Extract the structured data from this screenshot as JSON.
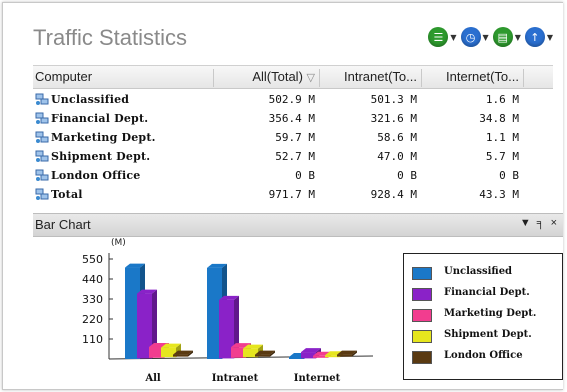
{
  "window": {
    "title": "Traffic Statistics"
  },
  "toolbar": {
    "buttons": [
      {
        "icon": "list-icon",
        "glyph": "☰",
        "color": "#2e9a2e"
      },
      {
        "icon": "clock-icon",
        "glyph": "◷",
        "color": "#2a6fd0"
      },
      {
        "icon": "export-icon",
        "glyph": "▤",
        "color": "#2e9a2e"
      },
      {
        "icon": "upload-icon",
        "glyph": "↑",
        "color": "#2a6fd0"
      }
    ]
  },
  "table": {
    "columns": [
      "Computer",
      "All(Total)",
      "Intranet(To...",
      "Internet(To..."
    ],
    "sort_indicator": "▽",
    "rows": [
      {
        "name": "Unclassified",
        "all": "502.9 M",
        "intranet": "501.3 M",
        "internet": "1.6 M"
      },
      {
        "name": "Financial Dept.",
        "all": "356.4 M",
        "intranet": "321.6 M",
        "internet": "34.8 M"
      },
      {
        "name": "Marketing Dept.",
        "all": "59.7 M",
        "intranet": "58.6 M",
        "internet": "1.1 M"
      },
      {
        "name": "Shipment Dept.",
        "all": "52.7 M",
        "intranet": "47.0 M",
        "internet": "5.7 M"
      },
      {
        "name": "London Office",
        "all": "0 B",
        "intranet": "0 B",
        "internet": "0 B"
      },
      {
        "name": "Total",
        "all": "971.7 M",
        "intranet": "928.4 M",
        "internet": "43.3 M"
      }
    ]
  },
  "panel": {
    "title": "Bar Chart",
    "controls": "▼ ╕ ×"
  },
  "chart_data": {
    "type": "bar",
    "ylabel": "(M)",
    "ylim": [
      0,
      550
    ],
    "yticks": [
      110,
      220,
      330,
      440,
      550
    ],
    "categories": [
      "All",
      "Intranet",
      "Internet"
    ],
    "series": [
      {
        "name": "Unclassified",
        "color": "#1a78c8",
        "values": [
          502.9,
          501.3,
          1.6
        ]
      },
      {
        "name": "Financial Dept.",
        "color": "#8a22c8",
        "values": [
          356.4,
          321.6,
          34.8
        ]
      },
      {
        "name": "Marketing Dept.",
        "color": "#f23d8f",
        "values": [
          59.7,
          58.6,
          1.1
        ]
      },
      {
        "name": "Shipment Dept.",
        "color": "#e6e61e",
        "values": [
          52.7,
          47.0,
          5.7
        ]
      },
      {
        "name": "London Office",
        "color": "#5a3a12",
        "values": [
          0,
          0,
          0
        ]
      }
    ],
    "legend_position": "right"
  }
}
